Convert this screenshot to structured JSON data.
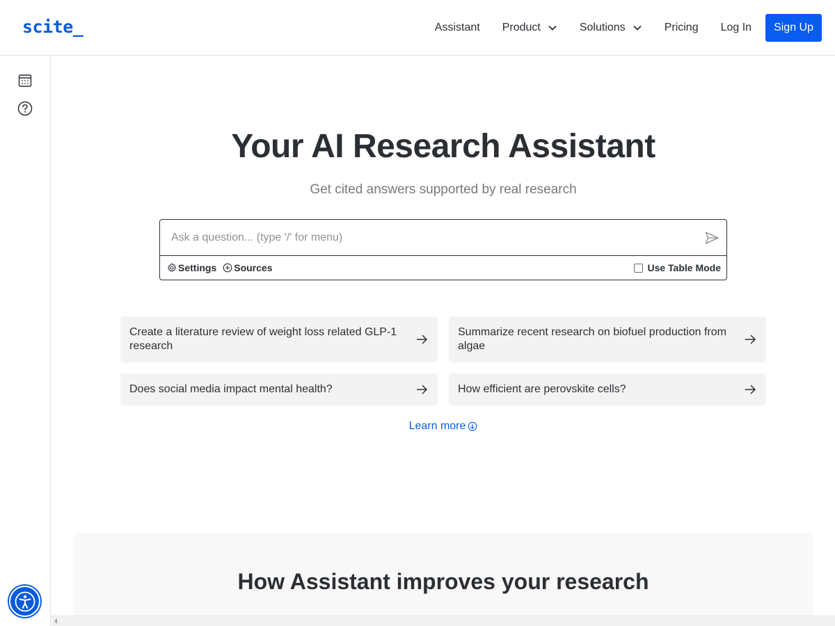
{
  "header": {
    "logo": "scite_",
    "nav": {
      "assistant": "Assistant",
      "product": "Product",
      "solutions": "Solutions",
      "pricing": "Pricing",
      "login": "Log In",
      "signup": "Sign Up"
    }
  },
  "sidebar": {
    "icons": [
      "calendar-icon",
      "help-icon"
    ],
    "accessibility_icon": "accessibility-icon"
  },
  "hero": {
    "title": "Your AI Research Assistant",
    "subtitle": "Get cited answers supported by real research"
  },
  "search": {
    "value": "",
    "placeholder": "Ask a question... (type '/' for menu)",
    "settings_label": "Settings",
    "sources_label": "Sources",
    "table_mode_label": "Use Table Mode",
    "table_mode_checked": false
  },
  "prompts": [
    "Create a literature review of weight loss related GLP-1 research",
    "Summarize recent research on biofuel production from algae",
    "Does social media impact mental health?",
    "How efficient are perovskite cells?"
  ],
  "learn_more": "Learn more",
  "section": {
    "title": "How Assistant improves your research"
  },
  "colors": {
    "brand": "#0a5bd9",
    "signup_bg": "#0a5bf0",
    "text": "#2b2f33",
    "card_bg": "#f3f3f3"
  }
}
